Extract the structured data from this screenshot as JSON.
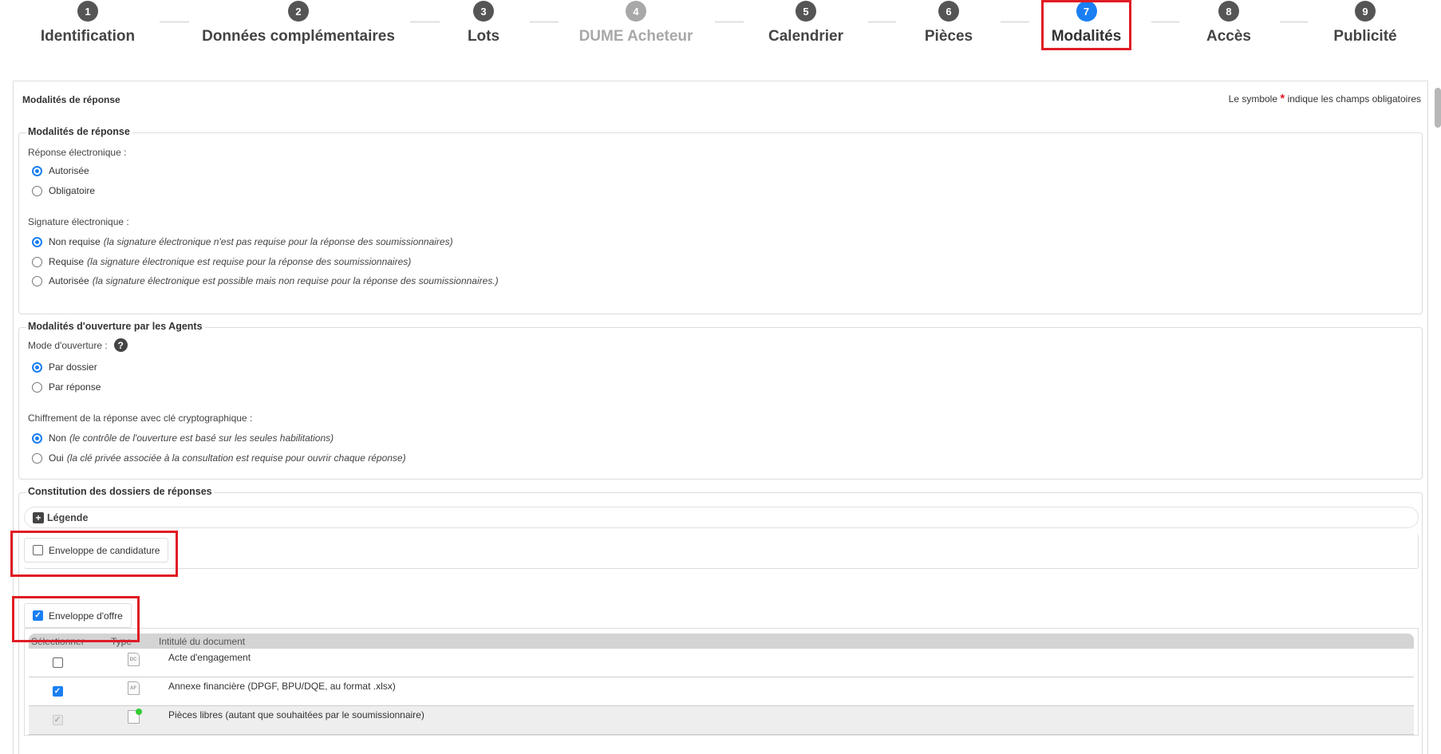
{
  "stepper": {
    "steps": [
      {
        "num": "1",
        "label": "Identification"
      },
      {
        "num": "2",
        "label": "Données complémentaires"
      },
      {
        "num": "3",
        "label": "Lots"
      },
      {
        "num": "4",
        "label": "DUME Acheteur"
      },
      {
        "num": "5",
        "label": "Calendrier"
      },
      {
        "num": "6",
        "label": "Pièces"
      },
      {
        "num": "7",
        "label": "Modalités"
      },
      {
        "num": "8",
        "label": "Accès"
      },
      {
        "num": "9",
        "label": "Publicité"
      }
    ],
    "active_step": "7",
    "disabled_step": "4",
    "active_color": "#1a7ff2",
    "highlight_color": "#e01c24"
  },
  "panel": {
    "title": "Modalités de réponse",
    "required_prefix": "Le symbole",
    "required_star": "*",
    "required_suffix": "indique les champs obligatoires"
  },
  "reponse": {
    "legend": "Modalités de réponse",
    "electronique_label": "Réponse électronique :",
    "electronique_options": [
      "Autorisée",
      "Obligatoire"
    ],
    "electronique_selected": "Autorisée",
    "signature_label": "Signature électronique :",
    "signature_options": [
      {
        "label": "Non requise",
        "desc": "(la signature électronique n'est pas requise pour la réponse des soumissionnaires)"
      },
      {
        "label": "Requise",
        "desc": "(la signature électronique est requise pour la réponse des soumissionnaires)"
      },
      {
        "label": "Autorisée",
        "desc": "(la signature électronique est possible mais non requise pour la réponse des soumissionnaires.)"
      }
    ],
    "signature_selected": "Non requise"
  },
  "ouverture": {
    "legend": "Modalités d'ouverture par les Agents",
    "mode_label": "Mode d'ouverture :",
    "help_icon": "?",
    "mode_options": [
      "Par dossier",
      "Par réponse"
    ],
    "mode_selected": "Par dossier",
    "chiffrement_label": "Chiffrement de la réponse avec clé cryptographique :",
    "chiffrement_options": [
      {
        "label": "Non",
        "desc": "(le contrôle de l'ouverture est basé sur les seules habilitations)"
      },
      {
        "label": "Oui",
        "desc": "(la clé privée associée à la consultation est requise pour ouvrir chaque réponse)"
      }
    ],
    "chiffrement_selected": "Non"
  },
  "constitution": {
    "legend": "Constitution des dossiers de réponses",
    "legende_toggle": "Légende",
    "legende_icon": "+",
    "candidature_label": "Enveloppe de candidature",
    "candidature_checked": false,
    "offre_label": "Enveloppe d'offre",
    "offre_checked": true,
    "table": {
      "headers": [
        "Sélectionner",
        "Type",
        "Intitulé du document"
      ],
      "rows": [
        {
          "selected": false,
          "disabled": false,
          "type_icon": "DC",
          "name": "Acte d'engagement"
        },
        {
          "selected": true,
          "disabled": false,
          "type_icon": "AF",
          "name": "Annexe financière (DPGF, BPU/DQE, au format .xlsx)"
        },
        {
          "selected": true,
          "disabled": true,
          "type_icon": "doc-add-icon",
          "name": "Pièces libres (autant que souhaitées par le soumissionnaire)"
        }
      ]
    }
  }
}
